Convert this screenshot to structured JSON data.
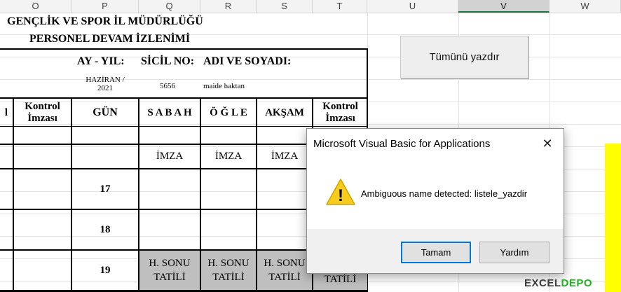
{
  "columns": [
    "O",
    "P",
    "Q",
    "R",
    "S",
    "T",
    "U",
    "V",
    "W"
  ],
  "selected_column": "V",
  "sheet": {
    "title1": "GENÇLİK VE SPOR İL MÜDÜRLÜĞÜ",
    "title2": "PERSONEL DEVAM İZLENİMİ",
    "ay_yil_label": "AY - YIL:",
    "sicil_label": "SİCİL NO:",
    "adi_label": "ADI VE SOYADI:",
    "month_value_line1": "HAZİRAN /",
    "month_value_line2": "2021",
    "sicil_value": "5656",
    "name_value": "maide haktan",
    "hdr_col_o": "l",
    "hdr_kontrol1_line1": "Kontrol",
    "hdr_kontrol1_line2": "İmzası",
    "hdr_gun": "GÜN",
    "hdr_sabah": "S A B A H",
    "hdr_ogle": "Ö Ğ L E",
    "hdr_aksam": "AKŞAM",
    "hdr_kontrol2_line1": "Kontrol",
    "hdr_kontrol2_line2": "İmzası",
    "imza": "İMZA",
    "days": [
      "17",
      "18",
      "19"
    ],
    "hsonu_line1": "H. SONU",
    "hsonu_line2": "TATİLİ",
    "tatili": "TATİLİ"
  },
  "print_button": "Tümünü yazdır",
  "dialog": {
    "title": "Microsoft Visual Basic for Applications",
    "message": "Ambiguous name detected: listele_yazdir",
    "ok_label": "Tamam",
    "help_label": "Yardım",
    "close_glyph": "✕",
    "warning_glyph": "!"
  },
  "watermark": {
    "part1": "EXCEL",
    "part2": "DEPO"
  }
}
